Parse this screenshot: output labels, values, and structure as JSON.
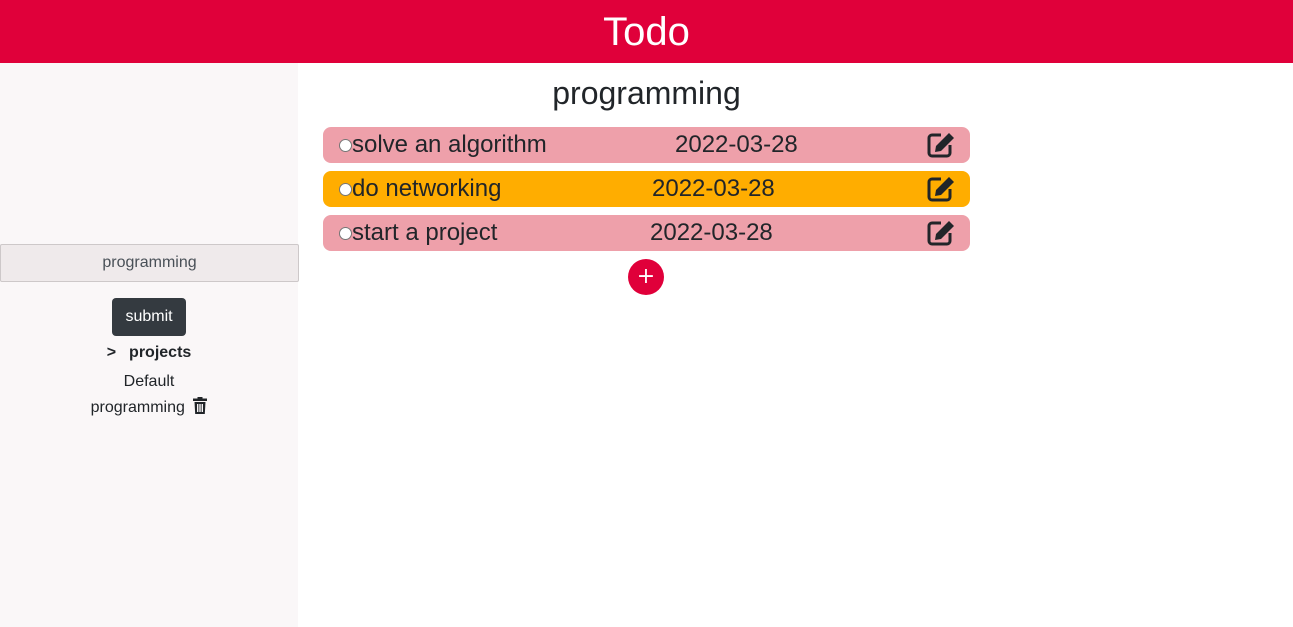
{
  "header": {
    "title": "Todo"
  },
  "sidebar": {
    "input_value": "programming",
    "submit_label": "submit",
    "projects_chevron": ">",
    "projects_label": "projects",
    "projects": [
      {
        "name": "Default"
      },
      {
        "name": "programming"
      }
    ]
  },
  "main": {
    "title": "programming",
    "todos": [
      {
        "title": "solve an algorithm",
        "date": "2022-03-28",
        "color": "#eea0aa"
      },
      {
        "title": "do networking",
        "date": "2022-03-28",
        "color": "#ffad00"
      },
      {
        "title": "start a project",
        "date": "2022-03-28",
        "color": "#eea0aa"
      }
    ],
    "add_label": "+"
  },
  "colors": {
    "accent": "#e0003a",
    "sidebar_bg": "#faf7f8",
    "button_dark": "#343a40"
  },
  "icons": {
    "edit": "edit-icon",
    "trash": "trash-icon"
  }
}
